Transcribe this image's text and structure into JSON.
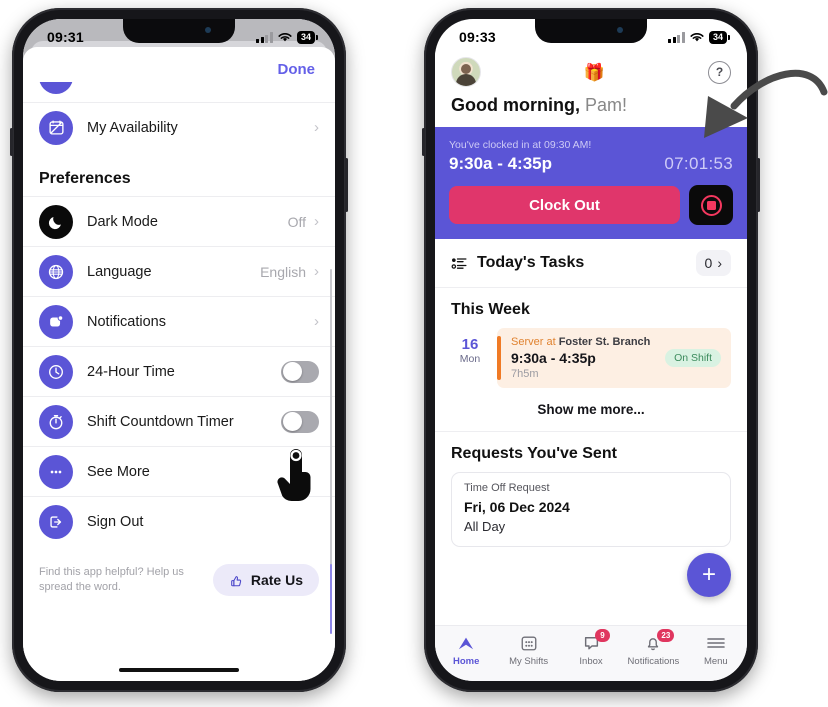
{
  "left_phone": {
    "status_bar": {
      "time": "09:31",
      "battery": "34",
      "signal_icon": "cellular-signal-icon",
      "wifi_icon": "wifi-icon"
    },
    "done_label": "Done",
    "top_item": {
      "label": "My Availability",
      "icon": "availability-calendar-icon",
      "chevron": "›"
    },
    "section_title": "Preferences",
    "preferences": [
      {
        "label": "Dark Mode",
        "value": "Off",
        "icon": "moon-icon",
        "control": "chevron"
      },
      {
        "label": "Language",
        "value": "English",
        "icon": "globe-icon",
        "control": "chevron"
      },
      {
        "label": "Notifications",
        "value": "",
        "icon": "bell-notification-icon",
        "control": "chevron"
      },
      {
        "label": "24-Hour Time",
        "value": "",
        "icon": "clock-icon",
        "control": "toggle",
        "toggle_on": false
      },
      {
        "label": "Shift Countdown Timer",
        "value": "",
        "icon": "stopwatch-icon",
        "control": "toggle",
        "toggle_on": false
      },
      {
        "label": "See More",
        "value": "",
        "icon": "ellipsis-icon",
        "control": "none"
      },
      {
        "label": "Sign Out",
        "value": "",
        "icon": "sign-out-icon",
        "control": "none"
      }
    ],
    "rate": {
      "text": "Find this app helpful? Help us spread the word.",
      "button_label": "Rate Us",
      "icon": "thumbs-up-icon"
    }
  },
  "right_phone": {
    "status_bar": {
      "time": "09:33",
      "battery": "34",
      "signal_icon": "cellular-signal-icon",
      "wifi_icon": "wifi-icon"
    },
    "header": {
      "avatar": "user-avatar",
      "gift_icon": "🎁",
      "help_label": "?"
    },
    "greeting_bold": "Good morning,",
    "greeting_name": " Pam!",
    "clock_card": {
      "subtitle": "You've clocked in at 09:30 AM!",
      "shift_time": "9:30a - 4:35p",
      "countdown": "07:01:53",
      "clock_out_label": "Clock Out",
      "record_icon": "stop-record-icon"
    },
    "tasks": {
      "icon": "checklist-icon",
      "title": "Today's Tasks",
      "count": "0",
      "chevron": "›"
    },
    "this_week": {
      "title": "This Week",
      "shift": {
        "day_number": "16",
        "day_name": "Mon",
        "role": "Server",
        "at": " at ",
        "location": "Foster St. Branch",
        "time": "9:30a - 4:35p",
        "duration": "7h5m",
        "status": "On Shift"
      },
      "show_more": "Show me more..."
    },
    "requests": {
      "title": "Requests You've Sent",
      "card": {
        "kind": "Time Off Request",
        "date": "Fri, 06 Dec 2024",
        "span": "All Day"
      }
    },
    "fab_label": "+",
    "tabs": [
      {
        "label": "Home",
        "icon": "home-chevron-icon",
        "badge": "",
        "active": true
      },
      {
        "label": "My Shifts",
        "icon": "calendar-grid-icon",
        "badge": "",
        "active": false
      },
      {
        "label": "Inbox",
        "icon": "chat-bubble-icon",
        "badge": "9",
        "active": false
      },
      {
        "label": "Notifications",
        "icon": "bell-icon",
        "badge": "23",
        "active": false
      },
      {
        "label": "Menu",
        "icon": "hamburger-menu-icon",
        "badge": "",
        "active": false
      }
    ]
  },
  "annotation": {
    "arrow": "curved-arrow-pointing-to-countdown"
  },
  "cursor": {
    "type": "pointing-hand-cursor"
  },
  "colors": {
    "accent_purple": "#5B55D6",
    "pink": "#E0366B",
    "orange": "#F07A25",
    "green": "#3C8B5D",
    "badge_red": "#E0365F"
  }
}
